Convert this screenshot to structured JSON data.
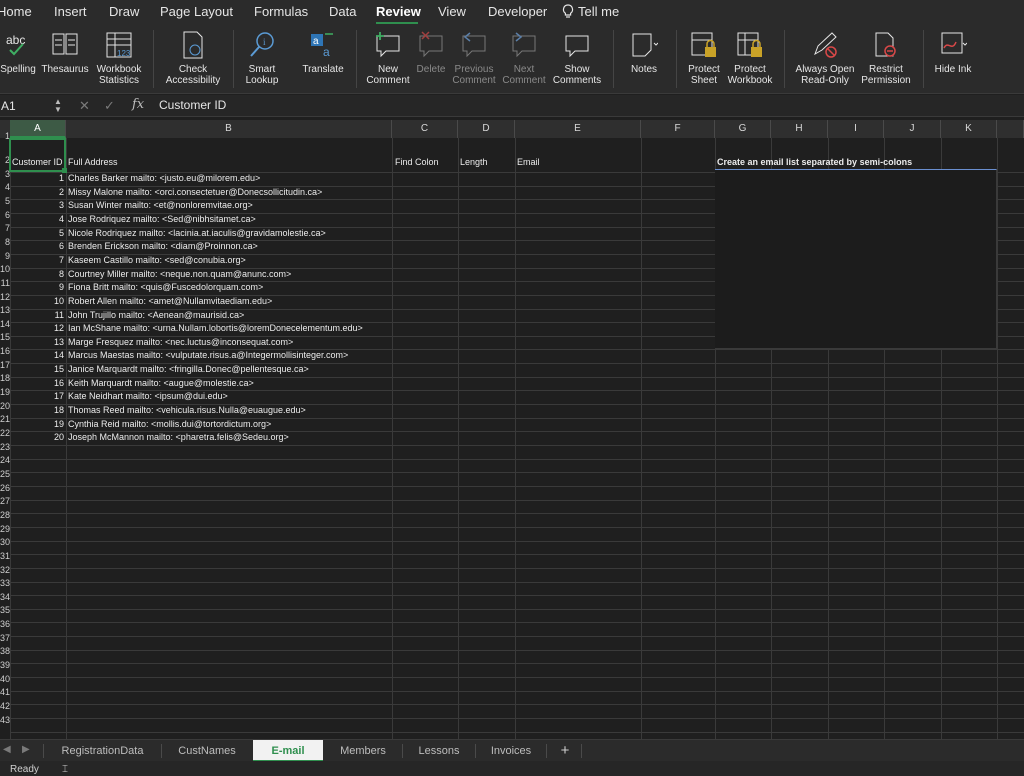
{
  "menu": [
    "Home",
    "Insert",
    "Draw",
    "Page Layout",
    "Formulas",
    "Data",
    "Review",
    "View",
    "Developer",
    "Tell me"
  ],
  "menu_active": "Review",
  "ribbon": {
    "spelling": "Spelling",
    "thesaurus": "Thesaurus",
    "workbook_stats": "Workbook\nStatistics",
    "check_access": "Check\nAccessibility",
    "smart_lookup": "Smart\nLookup",
    "translate": "Translate",
    "new_comment": "New\nComment",
    "delete": "Delete",
    "previous_comment": "Previous\nComment",
    "next_comment": "Next\nComment",
    "show_comments": "Show\nComments",
    "notes": "Notes",
    "protect_sheet": "Protect\nSheet",
    "protect_workbook": "Protect\nWorkbook",
    "always_open_readonly": "Always Open\nRead-Only",
    "restrict_permission": "Restrict\nPermission",
    "hide_ink": "Hide Ink"
  },
  "formula_bar": {
    "name_box": "A1",
    "fx": "fx",
    "content": "Customer ID"
  },
  "columns": [
    "A",
    "B",
    "C",
    "D",
    "E",
    "F",
    "G",
    "H",
    "I",
    "J",
    "K"
  ],
  "row_numbers": [
    "1",
    "2",
    "3",
    "4",
    "5",
    "6",
    "7",
    "8",
    "9",
    "10",
    "11",
    "12",
    "13",
    "14",
    "15",
    "16",
    "17",
    "18",
    "19",
    "20",
    "21",
    "22",
    "23",
    "24",
    "25",
    "26",
    "27",
    "28",
    "29",
    "30",
    "31",
    "32",
    "33",
    "34",
    "35",
    "36",
    "37",
    "38",
    "39",
    "40",
    "41",
    "42",
    "43"
  ],
  "headers": {
    "a": "Customer ID",
    "b": "Full Address",
    "c": "Find Colon",
    "d": "Length",
    "e": "Email",
    "g": "Create an email list separated by semi-colons"
  },
  "rows": [
    {
      "id": "1",
      "address": "Charles Barker mailto: <justo.eu@milorem.edu>"
    },
    {
      "id": "2",
      "address": "Missy Malone mailto: <orci.consectetuer@Donecsollicitudin.ca>"
    },
    {
      "id": "3",
      "address": "Susan Winter mailto: <et@nonloremvitae.org>"
    },
    {
      "id": "4",
      "address": "Jose Rodriquez mailto: <Sed@nibhsitamet.ca>"
    },
    {
      "id": "5",
      "address": "Nicole Rodriquez mailto: <lacinia.at.iaculis@gravidamolestie.ca>"
    },
    {
      "id": "6",
      "address": "Brenden Erickson mailto: <diam@Proinnon.ca>"
    },
    {
      "id": "7",
      "address": "Kaseem Castillo mailto: <sed@conubia.org>"
    },
    {
      "id": "8",
      "address": "Courtney Miller mailto: <neque.non.quam@anunc.com>"
    },
    {
      "id": "9",
      "address": "Fiona Britt mailto: <quis@Fuscedolorquam.com>"
    },
    {
      "id": "10",
      "address": "Robert Allen mailto: <amet@Nullamvitaediam.edu>"
    },
    {
      "id": "11",
      "address": "John Trujillo mailto: <Aenean@maurisid.ca>"
    },
    {
      "id": "12",
      "address": "Ian McShane mailto: <urna.Nullam.lobortis@loremDonecelementum.edu>"
    },
    {
      "id": "13",
      "address": "Marge Fresquez mailto: <nec.luctus@inconsequat.com>"
    },
    {
      "id": "14",
      "address": "Marcus Maestas mailto: <vulputate.risus.a@Integermollisinteger.com>"
    },
    {
      "id": "15",
      "address": "Janice Marquardt mailto: <fringilla.Donec@pellentesque.ca>"
    },
    {
      "id": "16",
      "address": "Keith Marquardt mailto: <augue@molestie.ca>"
    },
    {
      "id": "17",
      "address": "Kate Neidhart mailto: <ipsum@dui.edu>"
    },
    {
      "id": "18",
      "address": "Thomas Reed mailto: <vehicula.risus.Nulla@euaugue.edu>"
    },
    {
      "id": "19",
      "address": "Cynthia Reid mailto: <mollis.dui@tortordictum.org>"
    },
    {
      "id": "20",
      "address": "Joseph McMannon mailto: <pharetra.felis@Sedeu.org>"
    }
  ],
  "sheets": [
    "RegistrationData",
    "CustNames",
    "E-mail",
    "Members",
    "Lessons",
    "Invoices"
  ],
  "active_sheet": "E-mail",
  "add_sheet": "+",
  "status": "Ready",
  "accent_color": "#2f8f4e"
}
